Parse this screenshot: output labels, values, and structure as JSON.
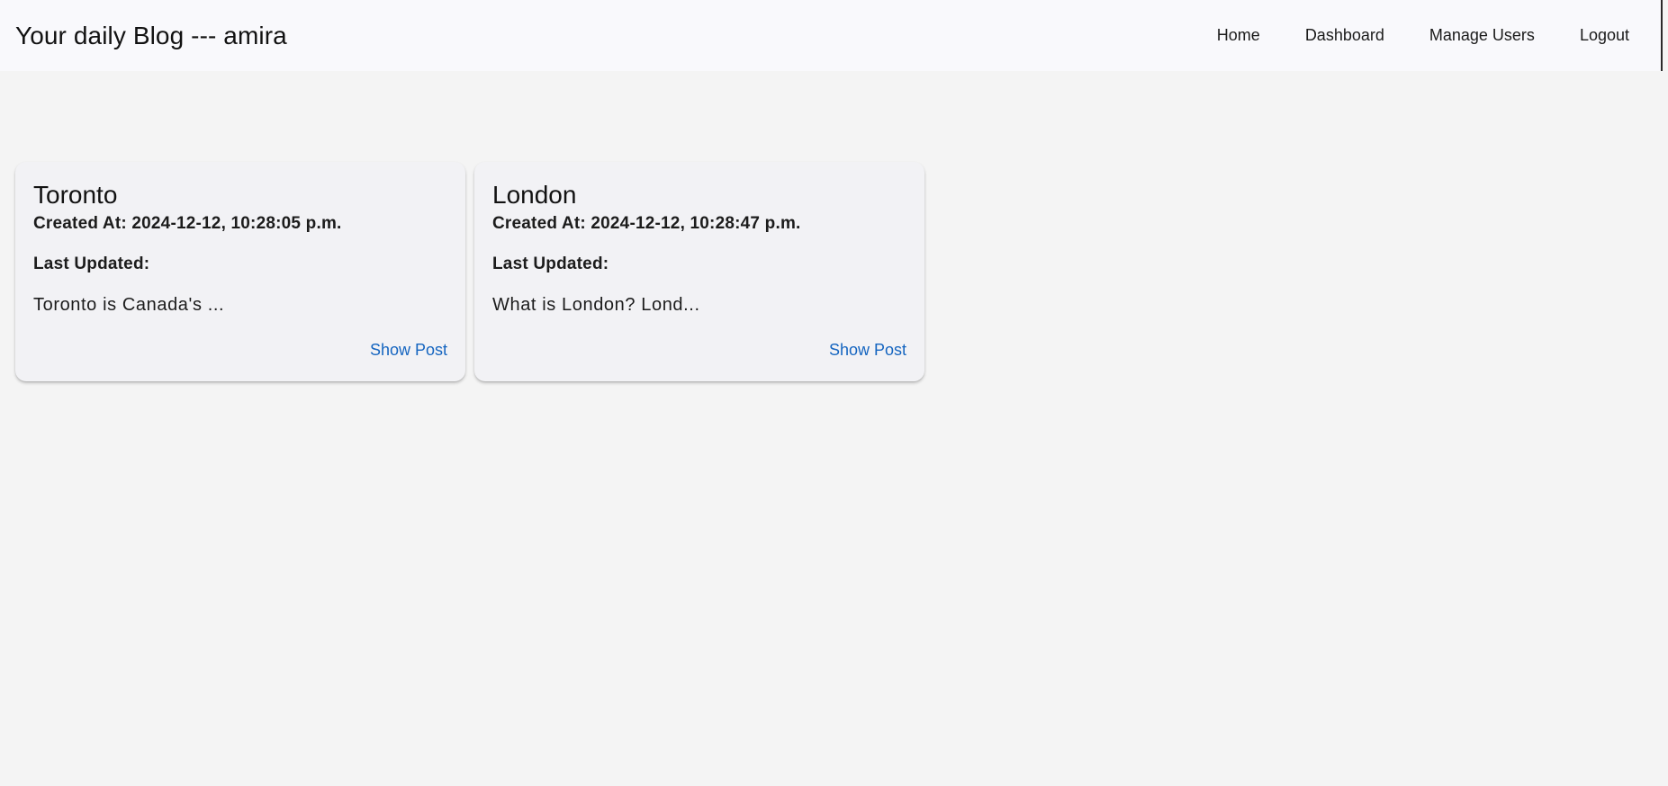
{
  "app_bar": {
    "title": "Your daily Blog --- amira",
    "nav": [
      {
        "label": "Home"
      },
      {
        "label": "Dashboard"
      },
      {
        "label": "Manage Users"
      },
      {
        "label": "Logout"
      }
    ]
  },
  "posts": [
    {
      "title": "Toronto",
      "created": "Created At: 2024-12-12, 10:28:05 p.m.",
      "updated": "Last Updated:",
      "excerpt": "Toronto is Canada's ...",
      "action": "Show Post"
    },
    {
      "title": "London",
      "created": "Created At: 2024-12-12, 10:28:47 p.m.",
      "updated": "Last Updated:",
      "excerpt": "What is London? Lond...",
      "action": "Show Post"
    }
  ],
  "colors": {
    "page_background": "#f4f4f4",
    "app_bar_background": "#f9f9fc",
    "card_background": "#f2f2f5",
    "link": "#1565c0",
    "text": "#121212"
  }
}
